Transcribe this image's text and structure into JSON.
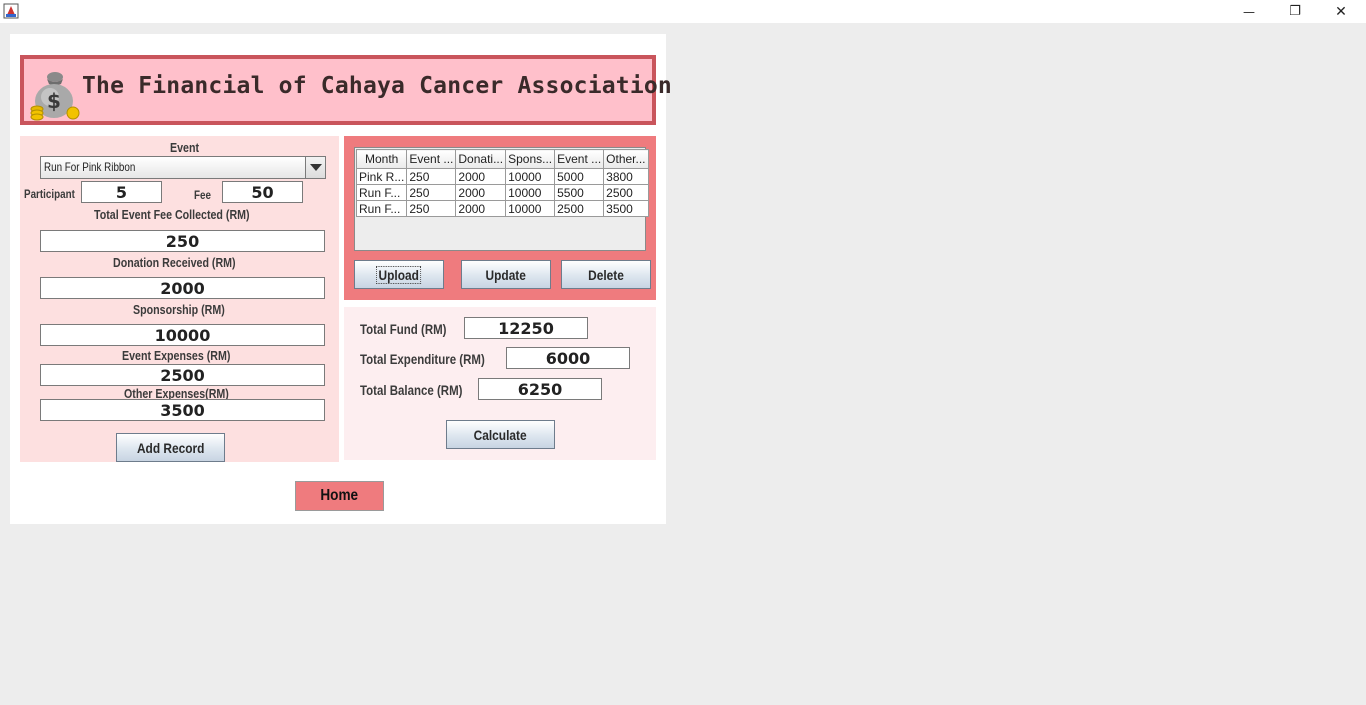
{
  "window": {
    "icons": {
      "app": "java-app-icon",
      "minimize": "minimize-icon",
      "maximize": "restore-icon",
      "close": "close-icon"
    },
    "minimize_glyph": "—",
    "maximize_glyph": "❐",
    "close_glyph": "✕"
  },
  "header": {
    "title": "The Financial of Cahaya Cancer Association",
    "icon": "money-bag-icon"
  },
  "form": {
    "event_label": "Event",
    "event_selected": "Run For Pink Ribbon",
    "participant_label": "Participant",
    "participant_value": "5",
    "fee_label": "Fee",
    "fee_value": "50",
    "total_event_fee_label": "Total Event Fee Collected (RM)",
    "total_event_fee_value": "250",
    "donation_label": "Donation Received (RM)",
    "donation_value": "2000",
    "sponsorship_label": "Sponsorship (RM)",
    "sponsorship_value": "10000",
    "event_expenses_label": "Event Expenses (RM)",
    "event_expenses_value": "2500",
    "other_expenses_label": "Other Expenses(RM)",
    "other_expenses_value": "3500",
    "add_record_label": "Add Record"
  },
  "table": {
    "headers": [
      "Month",
      "Event ...",
      "Donati...",
      "Spons...",
      "Event ...",
      "Other..."
    ],
    "rows": [
      [
        "Pink R...",
        "250",
        "2000",
        "10000",
        "5000",
        "3800"
      ],
      [
        "Run F...",
        "250",
        "2000",
        "10000",
        "5500",
        "2500"
      ],
      [
        "Run F...",
        "250",
        "2000",
        "10000",
        "2500",
        "3500"
      ]
    ],
    "upload_label": "Upload",
    "update_label": "Update",
    "delete_label": "Delete"
  },
  "totals": {
    "total_fund_label": "Total Fund (RM)",
    "total_fund_value": "12250",
    "total_expenditure_label": "Total Expenditure (RM)",
    "total_expenditure_value": "6000",
    "total_balance_label": "Total Balance (RM)",
    "total_balance_value": "6250",
    "calculate_label": "Calculate"
  },
  "nav": {
    "home_label": "Home"
  },
  "colors": {
    "header_bg": "#ffc0cb",
    "header_border": "#c9555c",
    "accent": "#ef7b7e",
    "left_panel_bg": "#fde0e0",
    "calc_panel_bg": "#fdeef0"
  }
}
